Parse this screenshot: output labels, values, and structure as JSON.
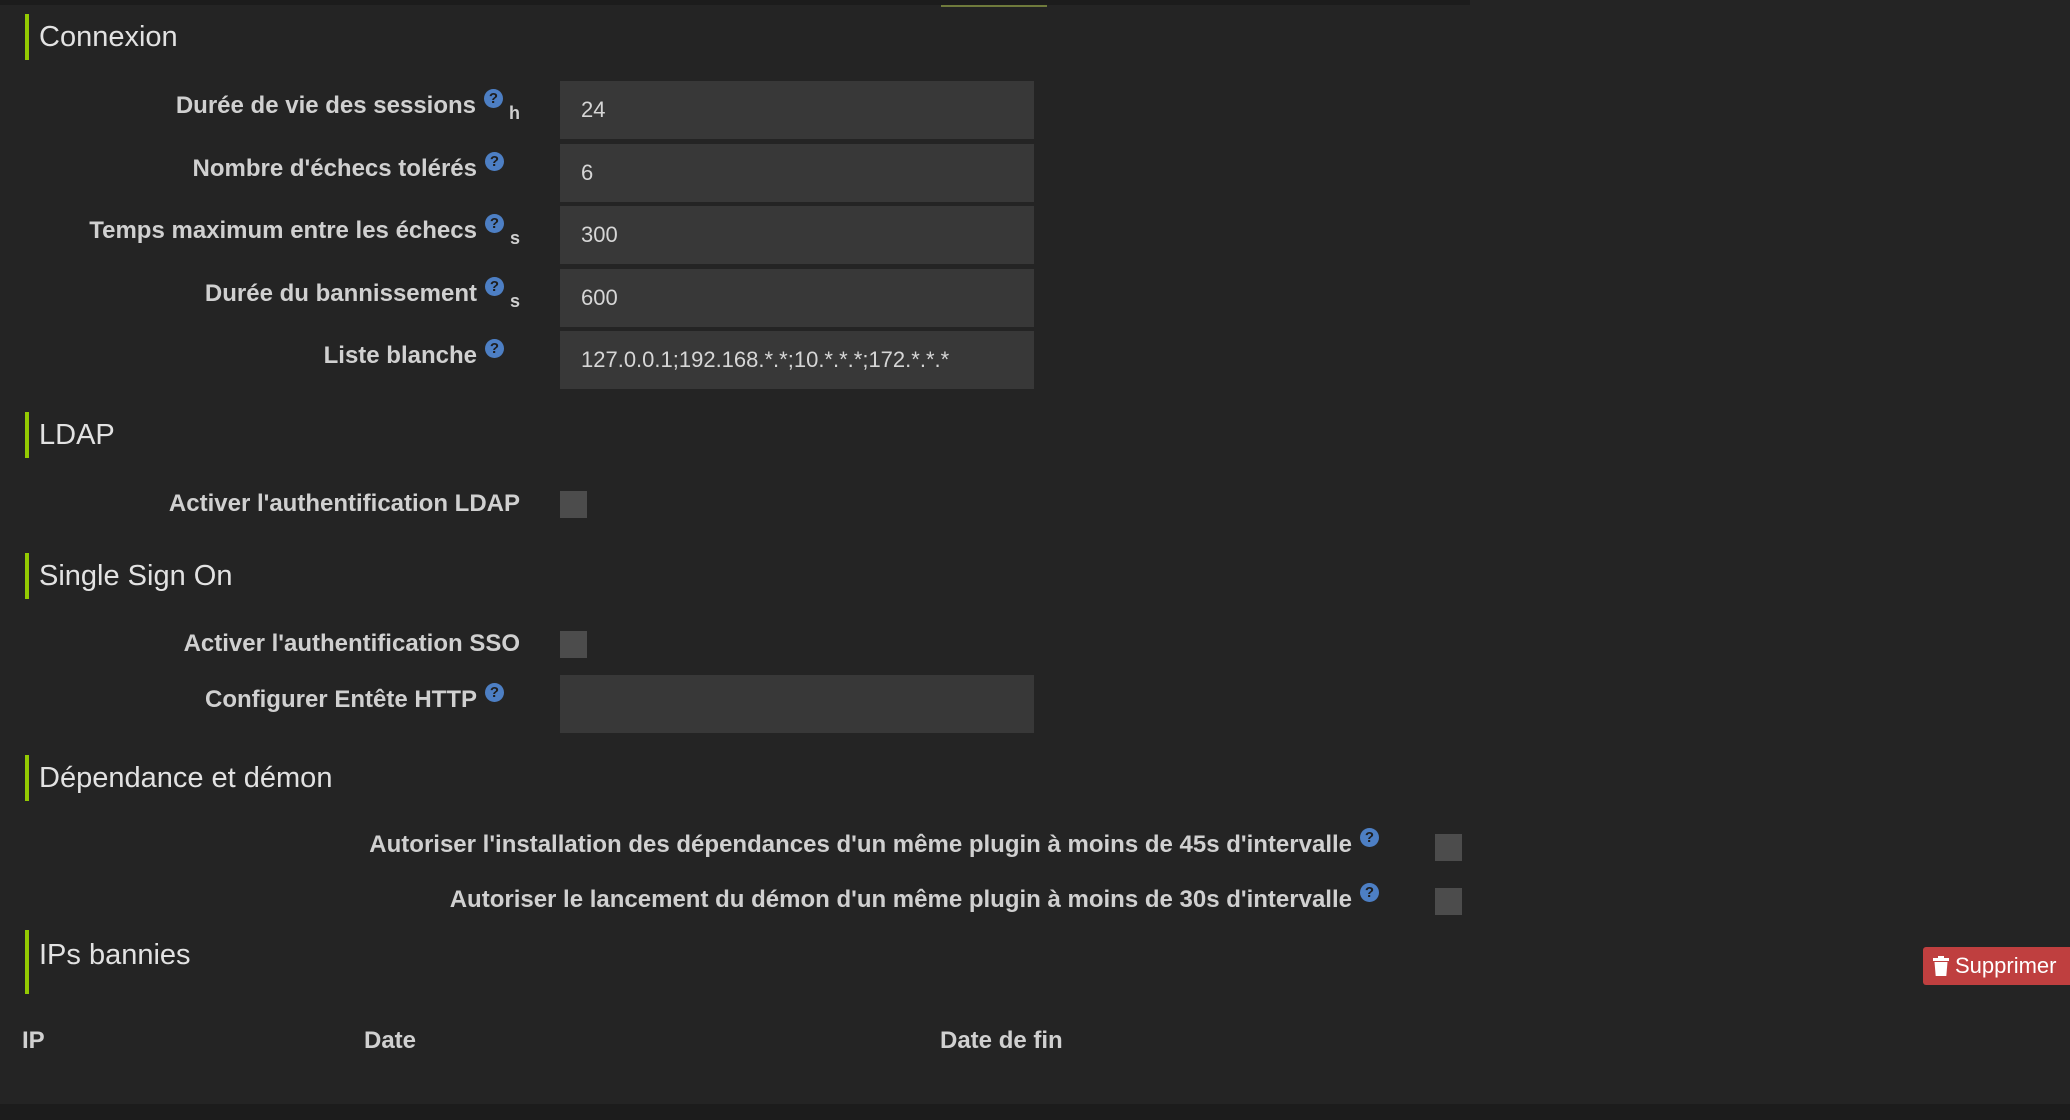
{
  "sections": {
    "connexion": {
      "title": "Connexion",
      "fields": [
        {
          "label": "Durée de vie des sessions",
          "unit": "h",
          "value": "24"
        },
        {
          "label": "Nombre d'échecs tolérés",
          "unit": "",
          "value": "6"
        },
        {
          "label": "Temps maximum entre les échecs",
          "unit": "s",
          "value": "300"
        },
        {
          "label": "Durée du bannissement",
          "unit": "s",
          "value": "600"
        },
        {
          "label": "Liste blanche",
          "unit": "",
          "value": "127.0.0.1;192.168.*.*;10.*.*.*;172.*.*.*"
        }
      ]
    },
    "ldap": {
      "title": "LDAP",
      "enable_label": "Activer l'authentification LDAP",
      "enabled": false
    },
    "sso": {
      "title": "Single Sign On",
      "enable_label": "Activer l'authentification SSO",
      "enabled": false,
      "header_label": "Configurer Entête HTTP",
      "header_value": ""
    },
    "dependency": {
      "title": "Dépendance et démon",
      "dep_label": "Autoriser l'installation des dépendances d'un même plugin à moins de 45s d'intervalle",
      "dep_checked": false,
      "daemon_label": "Autoriser le lancement du démon d'un même plugin à moins de 30s d'intervalle",
      "daemon_checked": false
    },
    "banned": {
      "title": "IPs bannies",
      "delete_label": "Supprimer",
      "columns": [
        "IP",
        "Date",
        "Date de fin"
      ],
      "rows": []
    }
  },
  "icons": {
    "help": "question-circle-icon",
    "trash": "trash-icon"
  },
  "colors": {
    "accent": "#93ca02",
    "help": "#4d7fc4",
    "danger": "#bf3f3f",
    "background": "#242424",
    "input": "#383838"
  }
}
